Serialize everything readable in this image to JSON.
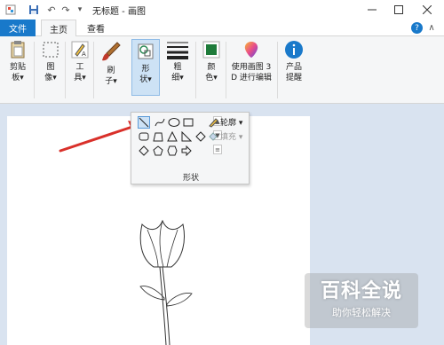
{
  "window": {
    "title": "无标题 - 画图",
    "undo_label": "↶",
    "redo_label": "↷",
    "customize_label": "▾"
  },
  "tabs": {
    "file": "文件",
    "home": "主页",
    "view": "查看"
  },
  "ribbon": {
    "clipboard": "剪贴\n板▾",
    "image": "图\n像▾",
    "tools": "工\n具▾",
    "brushes": "刷\n子▾",
    "shapes": "形\n状▾",
    "size": "粗\n细▾",
    "colors": "颜\n色▾",
    "paint3d": "使用画图 3\nD 进行编辑",
    "product_alert": "产品\n提醒"
  },
  "shapes_dropdown": {
    "outline_label": "轮廓 ▾",
    "fill_label": "填充 ▾",
    "group_label": "形状"
  },
  "watermark": {
    "title": "百科全说",
    "subtitle": "助你轻松解决"
  },
  "colors": {
    "accent": "#1979ca",
    "arrow": "#d9302a",
    "workspace": "#d9e3f0"
  }
}
